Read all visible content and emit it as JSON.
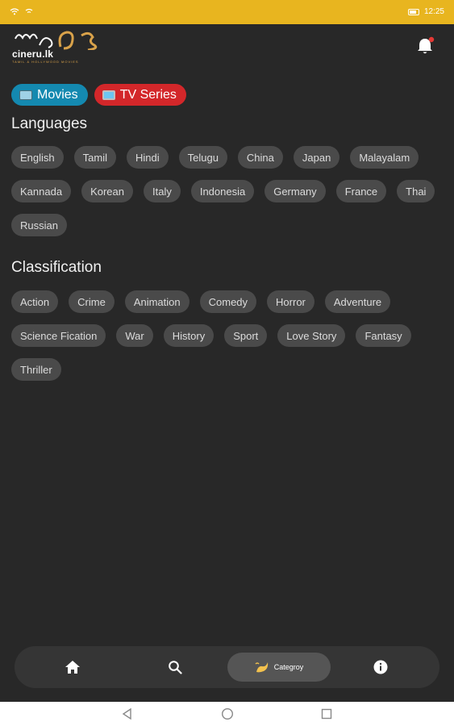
{
  "status_bar": {
    "time": "12:25"
  },
  "app": {
    "logo_text": "cineru.lk",
    "logo_sub": "TAMIL & HOLLYWOOD MOVIES"
  },
  "type_tabs": [
    {
      "label": "Movies",
      "color": "#1489b0"
    },
    {
      "label": "TV Series",
      "color": "#d3272a"
    }
  ],
  "languages": {
    "title": "Languages",
    "items": [
      "English",
      "Tamil",
      "Hindi",
      "Telugu",
      "China",
      "Japan",
      "Malayalam",
      "Kannada",
      "Korean",
      "Italy",
      "Indonesia",
      "Germany",
      "France",
      "Thai",
      "Russian"
    ]
  },
  "classification": {
    "title": "Classification",
    "items": [
      "Action",
      "Crime",
      "Animation",
      "Comedy",
      "Horror",
      "Adventure",
      "Science Fication",
      "War",
      "History",
      "Sport",
      "Love Story",
      "Fantasy",
      "Thriller"
    ]
  },
  "bottom_nav": {
    "items": [
      {
        "icon": "home-icon"
      },
      {
        "icon": "search-icon"
      },
      {
        "icon": "category-icon",
        "label": "Categroy",
        "active": true
      },
      {
        "icon": "info-icon"
      }
    ]
  },
  "colors": {
    "accent": "#e8b51f",
    "background": "#282828",
    "chip": "#4a4a4a"
  }
}
